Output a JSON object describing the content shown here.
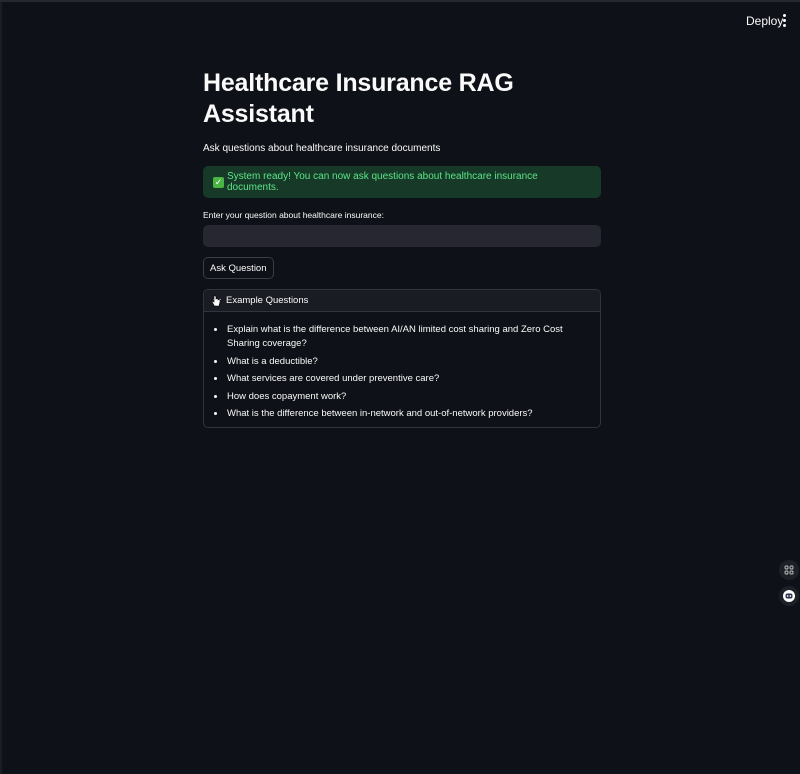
{
  "header": {
    "deploy_label": "Deploy"
  },
  "main": {
    "title": "Healthcare Insurance RAG Assistant",
    "subtitle": "Ask questions about healthcare insurance documents",
    "status_message": "System ready! You can now ask questions about healthcare insurance documents.",
    "question_label": "Enter your question about healthcare insurance:",
    "question_value": "",
    "ask_button_label": "Ask Question"
  },
  "examples": {
    "header_label": "Example Questions",
    "expanded": true,
    "items": [
      "Explain what is the difference between AI/AN limited cost sharing and Zero Cost Sharing coverage?",
      "What is a deductible?",
      "What services are covered under preventive care?",
      "How does copayment work?",
      "What is the difference between in-network and out-of-network providers?"
    ]
  },
  "colors": {
    "background": "#0e1117",
    "success_bg": "#173928",
    "success_text": "#5ce488",
    "input_bg": "#262730"
  },
  "icons": {
    "status": "check-icon",
    "expander": "chevron-down-icon",
    "menu": "vertical-dots-icon",
    "cursor": "pointer-cursor-icon",
    "side_1": "grid-apps-icon",
    "side_2": "bot-icon"
  }
}
